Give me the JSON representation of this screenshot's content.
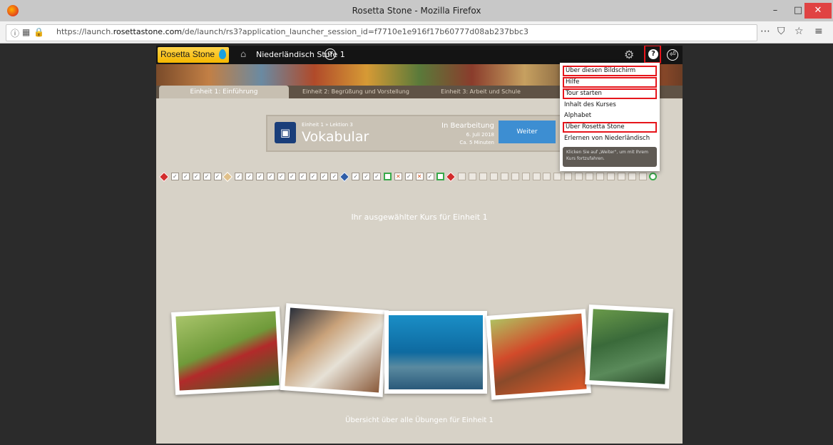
{
  "window": {
    "title": "Rosetta Stone - Mozilla Firefox",
    "minimize": "–",
    "maximize": "□",
    "close": "✕"
  },
  "browser": {
    "url_prefix": "https://launch.",
    "url_domain": "rosettastone.com",
    "url_path": "/de/launch/rs3?application_launcher_session_id=f7710e1e916f17b60777d08ab237bbc3",
    "reader_icon": "⋯",
    "pocket_icon": "⛉",
    "bookmark_icon": "☆",
    "menu_icon": "≡"
  },
  "app": {
    "logo": "Rosetta Stone",
    "course_title": "Niederländisch Stufe 1",
    "tabs": [
      "Einheit 1: Einführung",
      "Einheit 2: Begrüßung und Vorstellung",
      "Einheit 3: Arbeit und Schule"
    ],
    "lesson": {
      "subtitle": "Einheit 1 » Lektion 3",
      "name": "Vokabular",
      "status": "In Bearbeitung",
      "date": "6. Juli 2018",
      "duration": "Ca. 5 Minuten",
      "button": "Weiter"
    },
    "course_heading": "Ihr ausgewählter Kurs für Einheit 1",
    "overview_link": "Übersicht über alle Übungen für Einheit 1"
  },
  "help_menu": {
    "items": [
      {
        "label": "Über diesen Bildschirm",
        "highlighted": true
      },
      {
        "label": "Hilfe",
        "highlighted": true
      },
      {
        "label": "Tour starten",
        "highlighted": true
      },
      {
        "label": "Inhalt des Kurses",
        "highlighted": false
      },
      {
        "label": "Alphabet",
        "highlighted": false
      },
      {
        "label": "Über Rosetta Stone",
        "highlighted": true
      },
      {
        "label": "Erlernen von Niederländisch",
        "highlighted": false
      }
    ],
    "tip": "Klicken Sie auf „Weiter\", um mit Ihrem Kurs fortzufahren."
  },
  "colors": {
    "highlight": "#e6151b",
    "accent": "#3d8ed2",
    "logo": "#f5b700"
  }
}
